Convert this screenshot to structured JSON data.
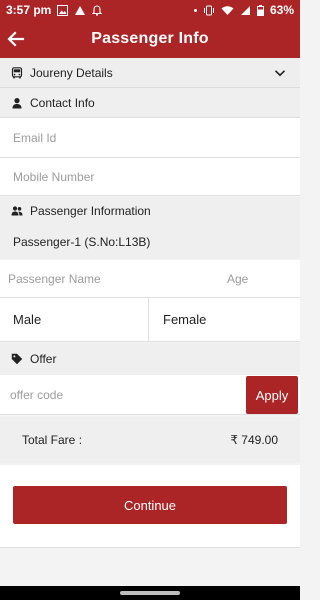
{
  "status_bar": {
    "time": "3:57 pm",
    "battery": "63%"
  },
  "app_bar": {
    "title": "Passenger Info"
  },
  "sections": {
    "journey": {
      "label": "Joureny Details"
    },
    "contact": {
      "label": "Contact Info"
    },
    "passenger": {
      "label": "Passenger Information"
    },
    "offer": {
      "label": "Offer"
    }
  },
  "contact": {
    "email_placeholder": "Email Id",
    "mobile_placeholder": "Mobile Number"
  },
  "passenger": {
    "title": "Passenger-1 (S.No:L13B)",
    "name_placeholder": "Passenger Name",
    "age_placeholder": "Age",
    "gender_options": [
      "Male",
      "Female"
    ]
  },
  "offer": {
    "code_placeholder": "offer code",
    "apply_label": "Apply"
  },
  "fare": {
    "label": "Total Fare :",
    "amount": "₹ 749.00"
  },
  "continue_label": "Continue",
  "colors": {
    "primary": "#ac2526",
    "background": "#f3f3f3"
  }
}
